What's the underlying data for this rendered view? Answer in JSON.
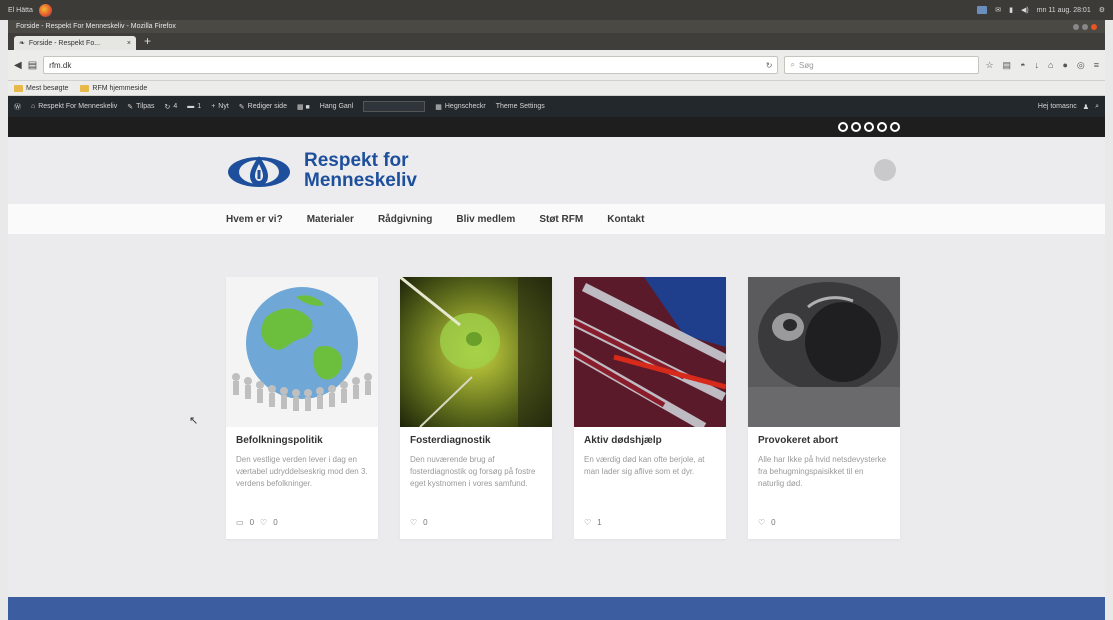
{
  "os_topbar": {
    "left_label": "El Hätta",
    "right_text": "mn 11 aug. 28:01"
  },
  "window": {
    "title": "Forside - Respekt For Menneskeliv - Mozilla Firefox"
  },
  "tab": {
    "label": "Forside - Respekt Fo...",
    "close": "×"
  },
  "navbar": {
    "url": "rfm.dk",
    "search_placeholder": "Søg"
  },
  "bookmarks": [
    {
      "label": "Mest besøgte"
    },
    {
      "label": "RFM hjemmeside"
    }
  ],
  "adminbar": {
    "site": "Respekt For Menneskeliv",
    "customize": "Tilpas",
    "updates": "4",
    "comments": "1",
    "new": "Nyt",
    "edit": "Rediger side",
    "search_label": "Hang Ganl",
    "theme_options": "Hegnscheckr",
    "theme_settings": "Theme Settings",
    "howdy": "Hej tomasnc"
  },
  "site": {
    "logo_line1": "Respekt for",
    "logo_line2": "Menneskeliv",
    "brand_color": "#1d4f9c",
    "menu": [
      {
        "label": "Hvem er vi?"
      },
      {
        "label": "Materialer"
      },
      {
        "label": "Rådgivning"
      },
      {
        "label": "Bliv medlem"
      },
      {
        "label": "Støt RFM"
      },
      {
        "label": "Kontakt"
      }
    ],
    "cards": [
      {
        "title": "Befolkningspolitik",
        "excerpt": "Den vestlige verden lever i dag en værtabel udryddelseskrig mod den 3. verdens befolkninger.",
        "comments": "0",
        "likes": "0"
      },
      {
        "title": "Fosterdiagnostik",
        "excerpt": "Den nuværende brug af fosterdiagnostik og forsøg på fostre eget kystnomen i vores samfund.",
        "comments": "",
        "likes": "0"
      },
      {
        "title": "Aktiv dødshjælp",
        "excerpt": "En værdig død kan ofte berjole, at man lader sig aflive som et dyr.",
        "comments": "",
        "likes": "1"
      },
      {
        "title": "Provokeret abort",
        "excerpt": "Alle har Ikke på hvid netsdevysterke fra behugmingspaisikket til en naturlig død.",
        "comments": "",
        "likes": "0"
      }
    ]
  }
}
